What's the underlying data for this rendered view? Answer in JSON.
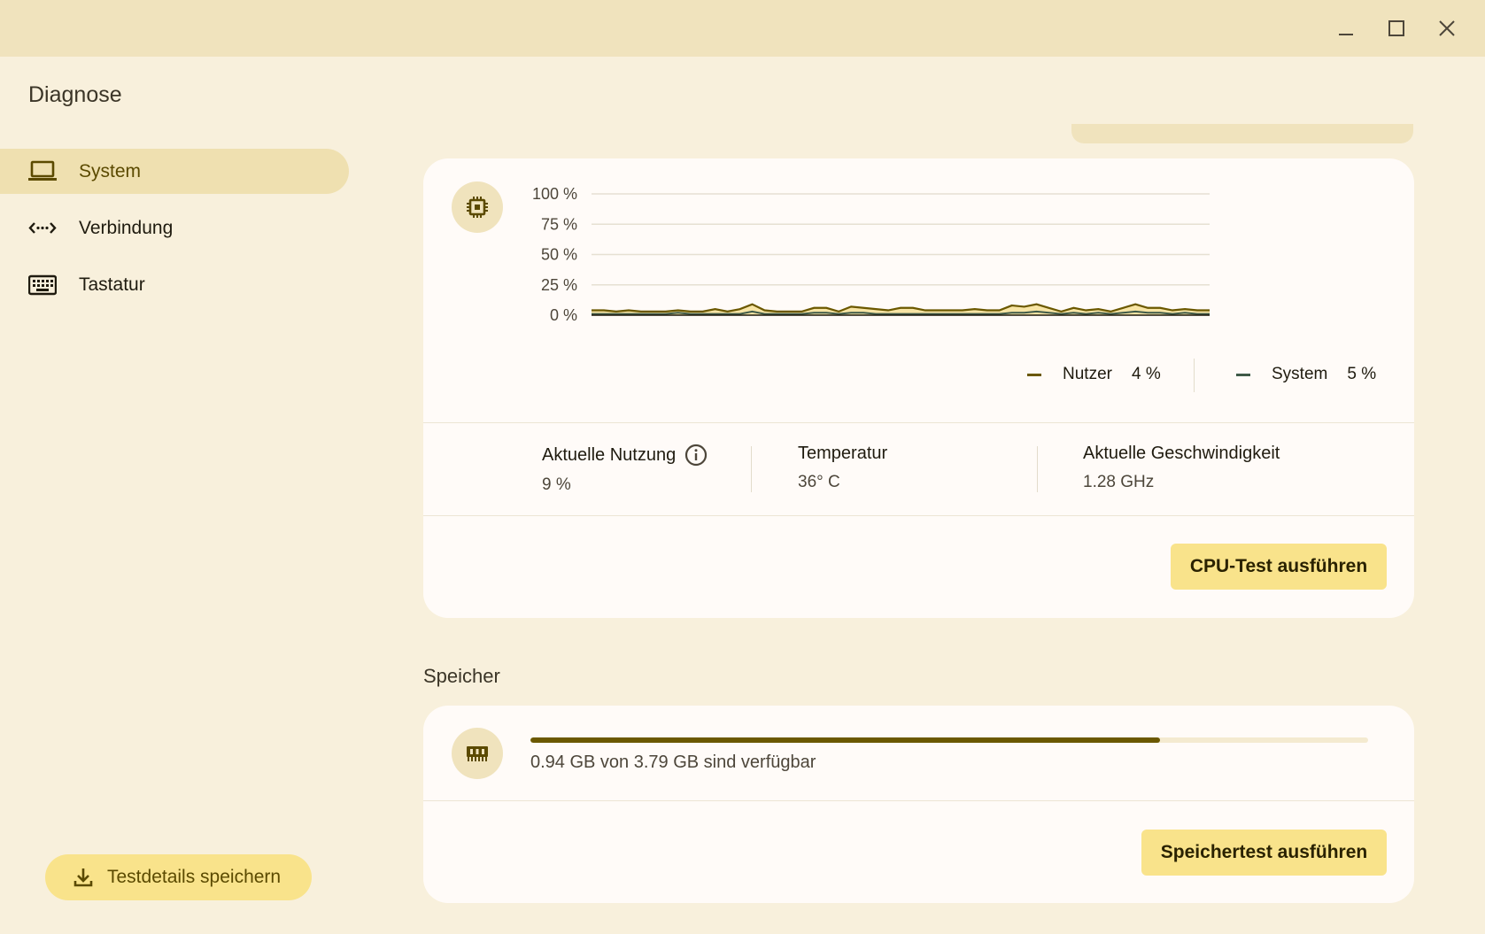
{
  "window": {
    "minimize_icon": "minimize-icon",
    "maximize_icon": "maximize-icon",
    "close_icon": "close-icon"
  },
  "app": {
    "title": "Diagnose"
  },
  "sidebar": {
    "items": [
      {
        "label": "System",
        "icon": "laptop-icon",
        "active": true
      },
      {
        "label": "Verbindung",
        "icon": "connection-icon",
        "active": false
      },
      {
        "label": "Tastatur",
        "icon": "keyboard-icon",
        "active": false
      }
    ],
    "save_button": {
      "label": "Testdetails speichern",
      "icon": "download-icon"
    }
  },
  "cpu": {
    "icon": "cpu-chip-icon",
    "chart_data": {
      "type": "area",
      "ylim": [
        0,
        100
      ],
      "yticks": [
        "100 %",
        "75 %",
        "50 %",
        "25 %",
        "0 %"
      ],
      "grid": true,
      "series": [
        {
          "name": "Nutzer",
          "color": "#6b5800",
          "values": [
            4,
            4,
            3,
            4,
            3,
            3,
            3,
            4,
            3,
            3,
            5,
            3,
            5,
            9,
            4,
            3,
            3,
            3,
            6,
            6,
            3,
            7,
            6,
            5,
            4,
            6,
            6,
            4,
            4,
            4,
            4,
            5,
            4,
            4,
            8,
            7,
            9,
            6,
            3,
            6,
            4,
            5,
            3,
            6,
            9,
            6,
            6,
            4,
            5,
            4,
            4
          ]
        },
        {
          "name": "System",
          "color": "#3f5a48",
          "values": [
            1,
            1,
            1,
            1,
            1,
            1,
            1,
            2,
            1,
            1,
            1,
            1,
            1,
            3,
            1,
            1,
            1,
            1,
            2,
            2,
            1,
            2,
            2,
            1,
            1,
            1,
            1,
            1,
            1,
            1,
            1,
            1,
            1,
            1,
            2,
            2,
            3,
            2,
            1,
            2,
            1,
            2,
            1,
            2,
            3,
            2,
            2,
            1,
            2,
            1,
            1
          ]
        }
      ],
      "legend": [
        {
          "name": "Nutzer",
          "value": "4 %",
          "color": "#6b5800"
        },
        {
          "name": "System",
          "value": "5 %",
          "color": "#3f5a48"
        }
      ]
    },
    "stats": {
      "usage_label": "Aktuelle Nutzung",
      "usage_value": "9 %",
      "temp_label": "Temperatur",
      "temp_value": "36° C",
      "speed_label": "Aktuelle Geschwindigkeit",
      "speed_value": "1.28 GHz"
    },
    "run_button": "CPU-Test ausführen"
  },
  "memory": {
    "section_title": "Speicher",
    "icon": "memory-chip-icon",
    "used_fraction": 0.752,
    "summary": "0.94 GB von 3.79 GB sind verfügbar",
    "run_button": "Speichertest ausführen"
  }
}
